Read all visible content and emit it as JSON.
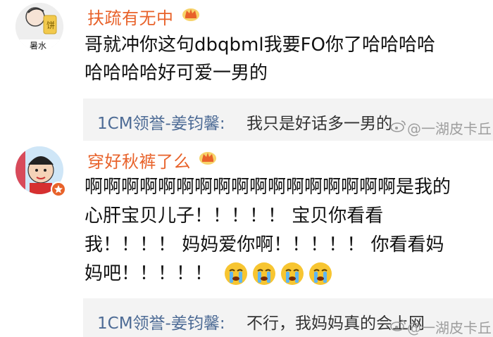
{
  "comments": [
    {
      "avatar_caption": "暑水",
      "username": "扶疏有无中",
      "text_lines": [
        "哥就冲你这句dbqbml我要FO你了哈哈哈哈",
        "哈哈哈哈好可爱一男的"
      ],
      "reply": {
        "author": "1CM领誉-姜钧馨:",
        "text": "我只是好话多一男的"
      }
    },
    {
      "username": "穿好秋裤了么",
      "text_lines": [
        "啊啊啊啊啊啊啊啊啊啊啊啊啊啊啊啊啊是我的",
        "心肝宝贝儿子！！！！！ 宝贝你看看",
        "我！！！！ 妈妈爱你啊！！！！！ 你看看妈",
        "妈吧！！！！！"
      ],
      "emoji_count": 4,
      "reply": {
        "author": "1CM领誉-姜钧馨:",
        "text": "不行，我妈妈真的会上网"
      }
    }
  ],
  "watermark": "@一湖皮卡丘",
  "colors": {
    "username": "#e8622a",
    "reply_author": "#4d6b95",
    "reply_bg": "#f3f3f3"
  },
  "icons": {
    "badge": "crown-badge-icon",
    "emoji": "crying-emoji-icon",
    "watermark": "weibo-logo-icon"
  }
}
